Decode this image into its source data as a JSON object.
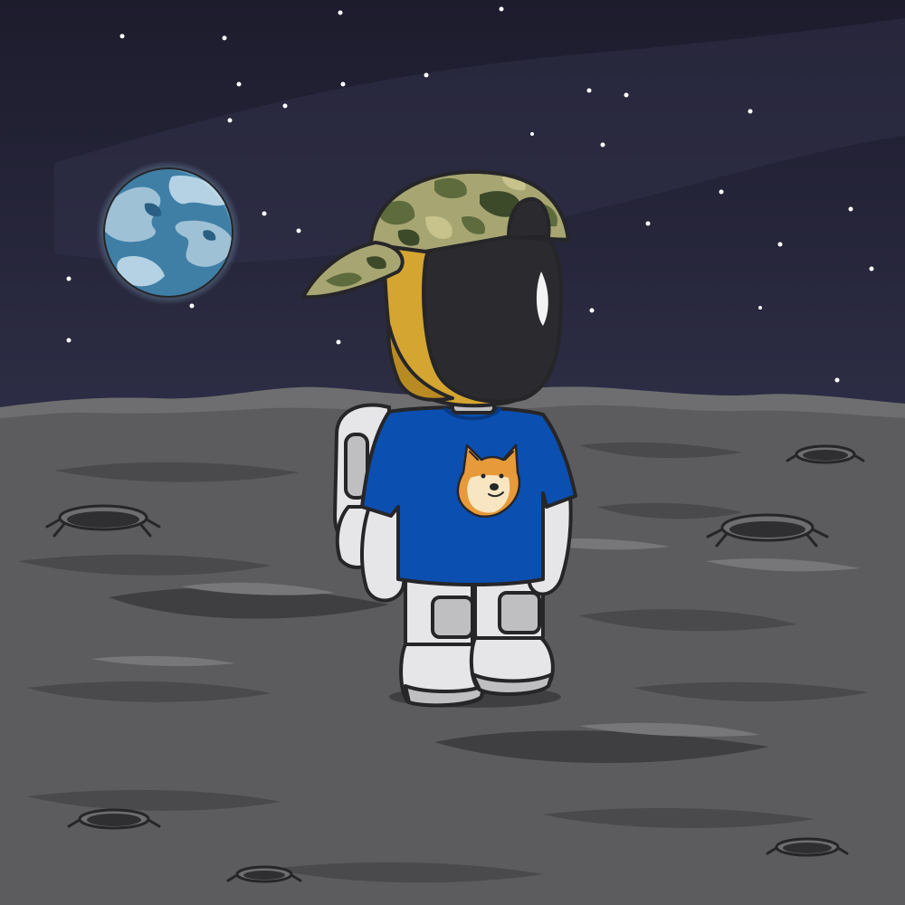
{
  "scene": {
    "subject": "astronaut",
    "colors": {
      "sky_top": "#1d1c2d",
      "sky_bottom": "#2b2b42",
      "ground": "#5c5c5e",
      "ground_dark": "#454547",
      "ground_light": "#6e6e70",
      "outline": "#262629",
      "shirt": "#0b4fb0",
      "visor": "#2a2a2f",
      "helmet_gold": "#d4a531",
      "suit": "#e6e6e8",
      "earth_ocean": "#3f7fa6",
      "earth_land": "#9fc1d6"
    },
    "icons": [
      "moon-surface",
      "earth-planet",
      "star",
      "crater",
      "astronaut",
      "camo-cap",
      "doge-face-print"
    ]
  }
}
